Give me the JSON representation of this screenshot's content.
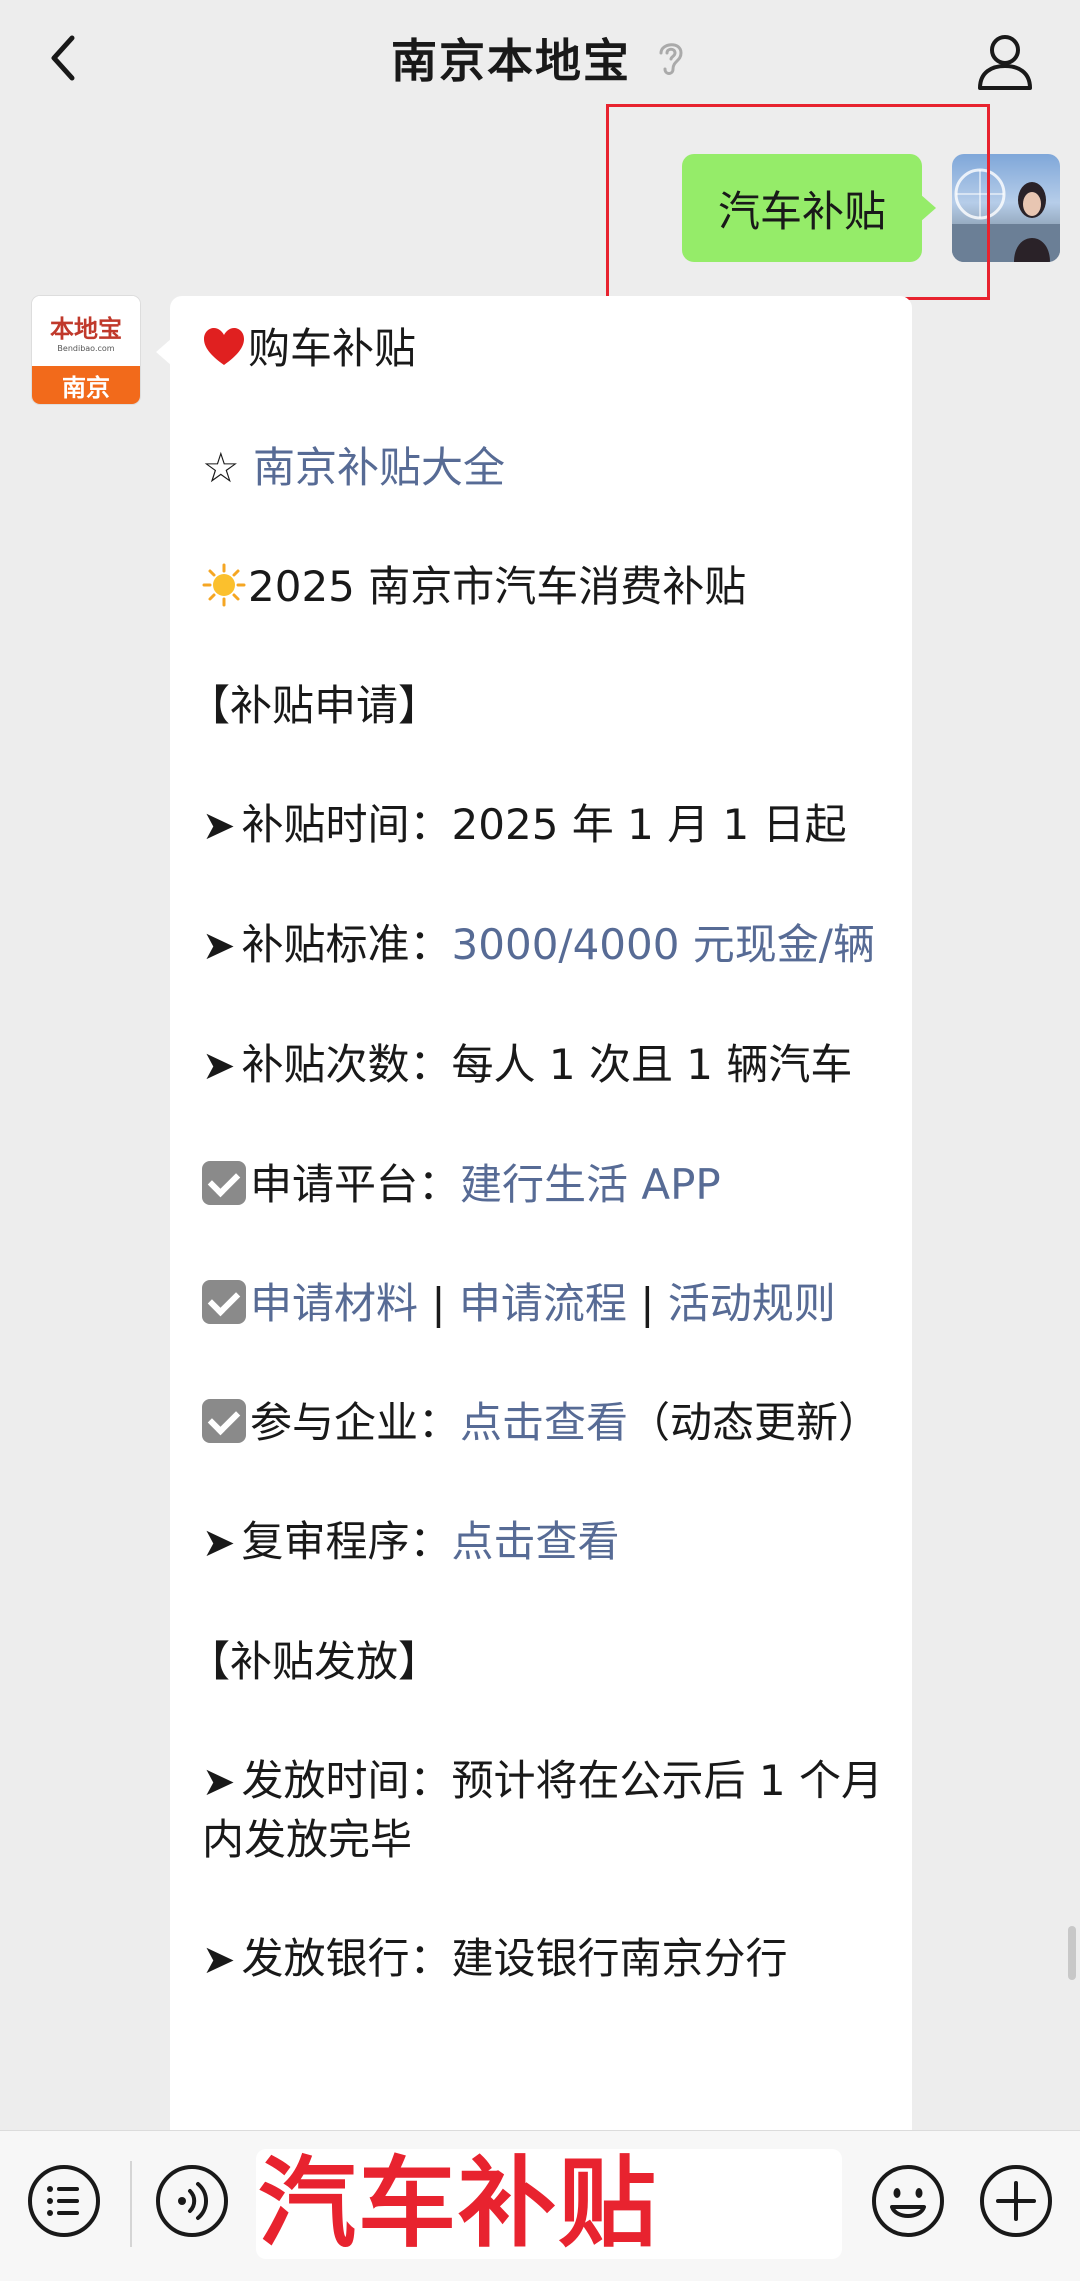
{
  "header": {
    "title": "南京本地宝"
  },
  "outgoing": {
    "text": "汽车补贴"
  },
  "bot_avatar": {
    "brand": "本地宝",
    "url": "Bendibao.com",
    "city": "南京"
  },
  "message": {
    "l1_text": "购车补贴",
    "l2_star": "☆",
    "l2_link": "南京补贴大全",
    "l3_text": "2025 南京市汽车消费补贴",
    "l4_heading": "【补贴申请】",
    "arrow": "➤",
    "l5_label": "补贴时间：",
    "l5_value": "2025 年 1 月 1 日起",
    "l6_label": "补贴标准：",
    "l6_value": "3000/4000 元现金/辆",
    "l7_label": "补贴次数：",
    "l7_value": "每人 1 次且 1 辆汽车",
    "l8_label": "申请平台：",
    "l8_link": "建行生活 APP",
    "l9_link1": "申请材料",
    "l9_sep": " | ",
    "l9_link2": "申请流程",
    "l9_link3": "活动规则",
    "l10_label": "参与企业：",
    "l10_link": "点击查看",
    "l10_note": "（动态更新）",
    "l11_label": "复审程序：",
    "l11_link": "点击查看",
    "l12_heading": "【补贴发放】",
    "l13_label": "发放时间：",
    "l13_value": "预计将在公示后 1 个月内发放完毕",
    "l14_label": "发放银行：",
    "l14_value": "建设银行南京分行"
  },
  "input": {
    "text": "汽车补贴"
  },
  "colors": {
    "link": "#576b95",
    "outgoing_bubble": "#95ec69",
    "highlight": "#e8232f"
  },
  "icons": [
    "back-icon",
    "ear-icon",
    "profile-icon",
    "heart-icon",
    "sun-icon",
    "checkbox-icon",
    "menu-icon",
    "voice-icon",
    "emoji-icon",
    "plus-icon"
  ]
}
